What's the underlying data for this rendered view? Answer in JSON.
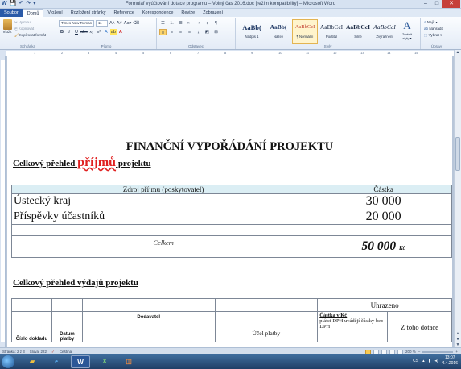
{
  "window": {
    "title": "Formulář vyúčtování dotace programu – Volný čas 2016.doc [režim kompatibility] – Microsoft Word",
    "controls": {
      "minimize": "–",
      "maximize": "□",
      "close": "✕"
    }
  },
  "quick_access": {
    "save_icon": "💾",
    "undo_icon": "↶",
    "redo_icon": "↷",
    "menu_icon": "▾"
  },
  "ribbon_tabs": [
    "Soubor",
    "Domů",
    "Vložení",
    "Rozložení stránky",
    "Reference",
    "Korespondence",
    "Revize",
    "Zobrazení"
  ],
  "ribbon": {
    "clipboard": {
      "paste": "Vložit",
      "cut": "Vyjmout",
      "copy": "Kopírovat",
      "format_painter": "Kopírovat formát",
      "label": "Schránka"
    },
    "font": {
      "name": "Times New Roman",
      "size": "11",
      "label": "Písmo",
      "grow": "A˄",
      "shrink": "A˅",
      "case": "Aa▾",
      "clear": "⌫",
      "bold": "B",
      "italic": "I",
      "underline": "U",
      "strike": "abc",
      "sub": "x₂",
      "sup": "x²",
      "effects": "A",
      "highlight": "ab",
      "color": "A"
    },
    "paragraph": {
      "label": "Odstavec"
    },
    "styles": {
      "label": "Styly",
      "items": [
        {
          "preview": "AaBb(",
          "name": "Nadpis 1"
        },
        {
          "preview": "AaBb(",
          "name": "Název"
        },
        {
          "preview": "AaBbCcI",
          "name": "¶ Normální"
        },
        {
          "preview": "AaBbCcI",
          "name": "Podtitul"
        },
        {
          "preview": "AaBbCcI",
          "name": "Silné"
        },
        {
          "preview": "AaBbCcI",
          "name": "Zvýraznění"
        }
      ],
      "change": "Změnit styly ▾"
    },
    "editing": {
      "label": "Úpravy",
      "find": "Najít ▾",
      "replace": "Nahradit",
      "select": "Vybrat ▾"
    }
  },
  "ruler_ticks": [
    "1",
    "2",
    "3",
    "4",
    "5",
    "6",
    "7",
    "8",
    "9",
    "10",
    "11",
    "12",
    "13",
    "14",
    "15"
  ],
  "document": {
    "title": "FINANČNÍ VYPOŘÁDÁNÍ PROJEKTU",
    "income_heading_pre": "Celkový  přehled ",
    "income_heading_word": "příjmů",
    "income_heading_post": " projektu",
    "income_table": {
      "col_source": "Zdroj příjmu (poskytovatel)",
      "col_amount": "Částka",
      "rows": [
        {
          "source": "Ústecký  kraj",
          "amount": "30 000"
        },
        {
          "source": "Příspěvky  účastníků",
          "amount": "20 000"
        }
      ],
      "total_label": "Celkem",
      "total_value": "50 000",
      "currency": "Kč"
    },
    "expense_heading": "Celkový přehled výdajů projektu",
    "expense_table": {
      "paid_header": "Uhrazeno",
      "col_doc": "Číslo dokladu",
      "col_date": "Datum platby",
      "col_supplier": "Dodavatel",
      "col_purpose": "Účel platby",
      "col_amount_kc": "Částka v Kč",
      "col_amount_note": "plátci DPH uvádějí částky bez DPH",
      "col_subsidy": "Z toho dotace"
    }
  },
  "status_bar": {
    "page": "Stránka: 2 z 3",
    "words": "Slova: 222",
    "lang": "Čeština",
    "zoom": "200 %"
  },
  "taskbar": {
    "time": "13:07",
    "date": "4.4.2016",
    "lang": "CS"
  }
}
